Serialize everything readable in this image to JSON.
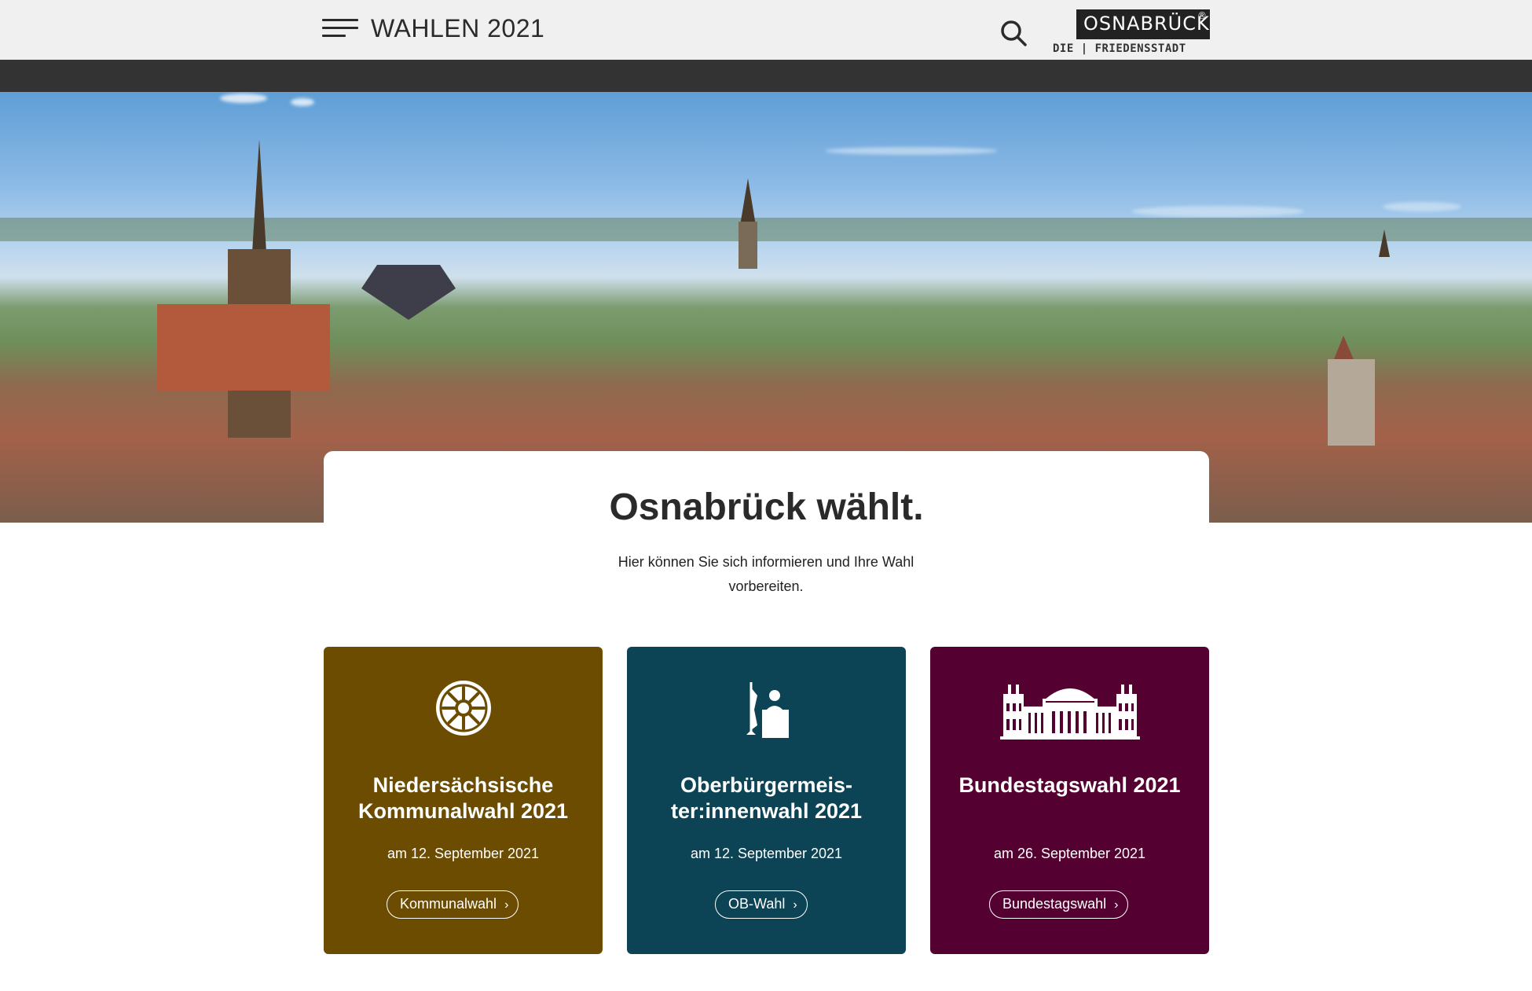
{
  "header": {
    "site_title": "WAHLEN 2021",
    "logo_main": "OSNABRÜCK",
    "logo_reg": "®",
    "logo_sub": "DIE | FRIEDENSSTADT"
  },
  "intro": {
    "title": "Osnabrück wählt.",
    "text": "Hier können Sie sich informieren und Ihre Wahl vorbereiten."
  },
  "cards": [
    {
      "title": "Niedersächsische Kommunalwahl 2021",
      "date": "am 12. September 2021",
      "button": "Kommunalwahl",
      "color": "#6b4c00",
      "icon": "wheel-coat-of-arms-icon"
    },
    {
      "title": "Oberbürgermeis-ter:innenwahl 2021",
      "date": "am 12. September 2021",
      "button": "OB-Wahl",
      "color": "#0c4456",
      "icon": "mayor-desk-icon"
    },
    {
      "title": "Bundestagswahl 2021",
      "date": "am 26. September 2021",
      "button": "Bundestagswahl",
      "color": "#540030",
      "icon": "reichstag-icon"
    }
  ]
}
